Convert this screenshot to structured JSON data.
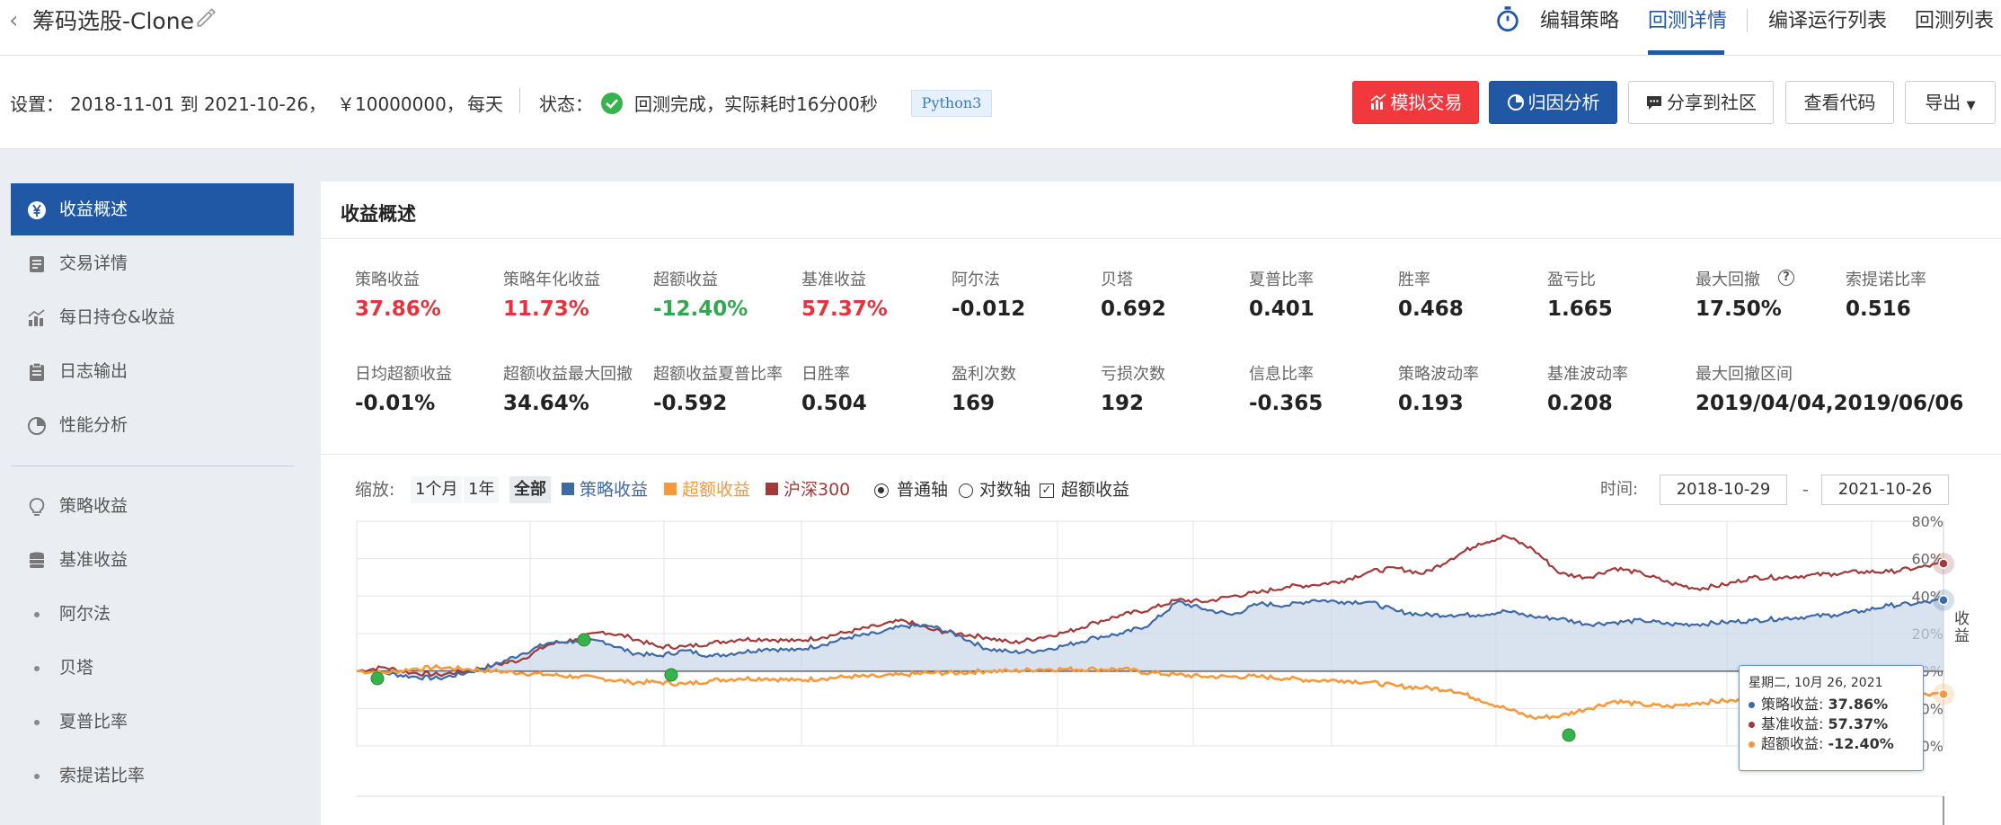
{
  "header": {
    "back_icon": "chevron-left-icon",
    "title": "筹码选股-Clone",
    "edit_icon": "pencil-icon",
    "nav": [
      {
        "label": "编辑策略",
        "icon": "stopwatch-icon"
      },
      {
        "label": "回测详情",
        "active": true
      },
      {
        "label": "编译运行列表"
      },
      {
        "label": "回测列表"
      }
    ]
  },
  "settings": {
    "label": "设置：",
    "range": "2018-11-01 到 2021-10-26，",
    "capital": "￥10000000，",
    "freq": "每天",
    "status_label": "状态：",
    "status_text": "回测完成，实际耗时16分00秒",
    "lang": "Python3"
  },
  "actions": {
    "sim_trade": "模拟交易",
    "attribution": "归因分析",
    "share": "分享到社区",
    "view_code": "查看代码",
    "export": "导出"
  },
  "sidebar": {
    "items": [
      {
        "label": "收益概述",
        "icon": "yen-circle-icon",
        "active": true
      },
      {
        "label": "交易详情",
        "icon": "document-icon"
      },
      {
        "label": "每日持仓&收益",
        "icon": "bar-chart-icon"
      },
      {
        "label": "日志输出",
        "icon": "clipboard-icon"
      },
      {
        "label": "性能分析",
        "icon": "pie-chart-icon"
      }
    ],
    "items2": [
      {
        "label": "策略收益",
        "icon": "lightbulb-icon"
      },
      {
        "label": "基准收益",
        "icon": "database-icon"
      }
    ],
    "subitems": [
      {
        "label": "阿尔法"
      },
      {
        "label": "贝塔"
      },
      {
        "label": "夏普比率"
      },
      {
        "label": "索提诺比率"
      }
    ]
  },
  "panel": {
    "title": "收益概述",
    "metrics_row1": [
      {
        "label": "策略收益",
        "value": "37.86%",
        "color": "red"
      },
      {
        "label": "策略年化收益",
        "value": "11.73%",
        "color": "red"
      },
      {
        "label": "超额收益",
        "value": "-12.40%",
        "color": "green"
      },
      {
        "label": "基准收益",
        "value": "57.37%",
        "color": "red"
      },
      {
        "label": "阿尔法",
        "value": "-0.012"
      },
      {
        "label": "贝塔",
        "value": "0.692"
      },
      {
        "label": "夏普比率",
        "value": "0.401"
      },
      {
        "label": "胜率",
        "value": "0.468"
      },
      {
        "label": "盈亏比",
        "value": "1.665"
      },
      {
        "label": "最大回撤",
        "value": "17.50%",
        "help": true
      },
      {
        "label": "索提诺比率",
        "value": "0.516"
      }
    ],
    "metrics_row2": [
      {
        "label": "日均超额收益",
        "value": "-0.01%"
      },
      {
        "label": "超额收益最大回撤",
        "value": "34.64%"
      },
      {
        "label": "超额收益夏普比率",
        "value": "-0.592"
      },
      {
        "label": "日胜率",
        "value": "0.504"
      },
      {
        "label": "盈利次数",
        "value": "169"
      },
      {
        "label": "亏损次数",
        "value": "192"
      },
      {
        "label": "信息比率",
        "value": "-0.365"
      },
      {
        "label": "策略波动率",
        "value": "0.193"
      },
      {
        "label": "基准波动率",
        "value": "0.208"
      },
      {
        "label": "最大回撤区间",
        "value": "2019/04/04,2019/06/06"
      }
    ]
  },
  "chart_toolbar": {
    "zoom_label": "缩放:",
    "zoom": [
      "1个月",
      "1年",
      "全部"
    ],
    "legend": [
      {
        "label": "策略收益",
        "color": "#3e6aa5"
      },
      {
        "label": "超额收益",
        "color": "#f7993a"
      },
      {
        "label": "沪深300",
        "color": "#a33a3a"
      }
    ],
    "axis_normal": "普通轴",
    "axis_log": "对数轴",
    "excess_toggle": "超额收益",
    "time_label": "时间:",
    "date_from": "2018-10-29",
    "date_sep": "-",
    "date_to": "2021-10-26"
  },
  "chart_data": {
    "type": "line",
    "y_ticks": [
      "80%",
      "60%",
      "40%",
      "20%",
      "0%",
      "-20%",
      "-40%"
    ],
    "ylim": [
      -40,
      80
    ],
    "x_range": [
      "2018-10-29",
      "2021-10-26"
    ],
    "series": [
      {
        "name": "沪深300",
        "color": "#a33a3a",
        "values": [
          0,
          2,
          -1,
          -2,
          0,
          3,
          6,
          14,
          17,
          21,
          18,
          13,
          13,
          15,
          17,
          17,
          16,
          18,
          21,
          24,
          27,
          22,
          20,
          18,
          15,
          18,
          21,
          26,
          30,
          33,
          38,
          37,
          40,
          42,
          45,
          46,
          48,
          53,
          55,
          52,
          60,
          68,
          72,
          65,
          52,
          50,
          55,
          52,
          47,
          44,
          46,
          50,
          50,
          51,
          52,
          53,
          53,
          55,
          57.37
        ]
      },
      {
        "name": "策略收益",
        "color": "#3e6aa5",
        "values": [
          0,
          -1,
          -3,
          -4,
          -1,
          3,
          9,
          15,
          16,
          16,
          10,
          8,
          11,
          8,
          10,
          12,
          11,
          14,
          18,
          20,
          24,
          24,
          19,
          12,
          10,
          11,
          14,
          18,
          20,
          25,
          37,
          33,
          30,
          36,
          35,
          38,
          37,
          37,
          32,
          30,
          30,
          30,
          32,
          29,
          28,
          25,
          26,
          27,
          25,
          25,
          26,
          27,
          28,
          29,
          30,
          32,
          35,
          36,
          37.86
        ]
      },
      {
        "name": "超额收益",
        "color": "#f7993a",
        "values": [
          0,
          -1,
          1,
          2,
          1,
          0,
          -1,
          -2,
          -3,
          -4,
          -6,
          -6,
          -7,
          -5,
          -4,
          -4,
          -5,
          -4,
          -3,
          -3,
          -2,
          -1,
          -1,
          0,
          0,
          1,
          1,
          1,
          1,
          -1,
          -2,
          -3,
          -3,
          -3,
          -4,
          -5,
          -5,
          -6,
          -8,
          -9,
          -10,
          -15,
          -20,
          -25,
          -24,
          -20,
          -16,
          -18,
          -19,
          -17,
          -16,
          -16,
          -16,
          -15,
          -15,
          -14,
          -13,
          -13,
          -12.4
        ]
      }
    ]
  },
  "tooltip": {
    "date": "星期二, 10月 26, 2021",
    "rows": [
      {
        "label": "策略收益:",
        "value": "37.86%",
        "color": "#3e6aa5"
      },
      {
        "label": "基准收益:",
        "value": "57.37%",
        "color": "#a33a3a"
      },
      {
        "label": "超额收益:",
        "value": "-12.40%",
        "color": "#f7993a"
      }
    ]
  },
  "side_label": "收益"
}
